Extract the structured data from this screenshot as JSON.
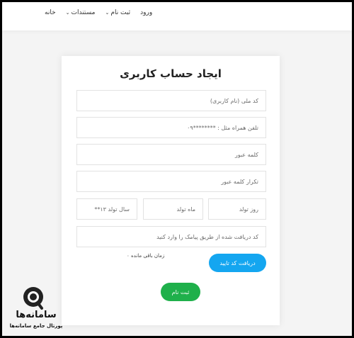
{
  "nav": {
    "home": "خانه",
    "docs": "مستندات",
    "signup": "ثبت نام",
    "login": "ورود"
  },
  "form": {
    "title": "ایجاد حساب کاربری",
    "national_code_placeholder": "کد ملی (نام کاربری)",
    "phone_placeholder": "تلفن همراه مثل : ********۰۹",
    "password_placeholder": "کلمه عبور",
    "password_repeat_placeholder": "تکرار کلمه عبور",
    "birth_day_placeholder": "روز تولد",
    "birth_month_placeholder": "ماه تولد",
    "birth_year_placeholder": "سال تولد ۱۳**",
    "sms_code_placeholder": "کد دریافت شده از طریق پیامک را وارد کنید",
    "timer_text": "زمان باقی مانده ۰",
    "get_code_button": "دریافت کد تایید",
    "register_button": "ثبت نام"
  },
  "watermark": {
    "name": "سامانه‌ها",
    "subtitle": "پورتال جامع سامانه‌ها"
  },
  "colors": {
    "get_code_button": "#14a6f0",
    "register_button": "#1fb04b"
  }
}
